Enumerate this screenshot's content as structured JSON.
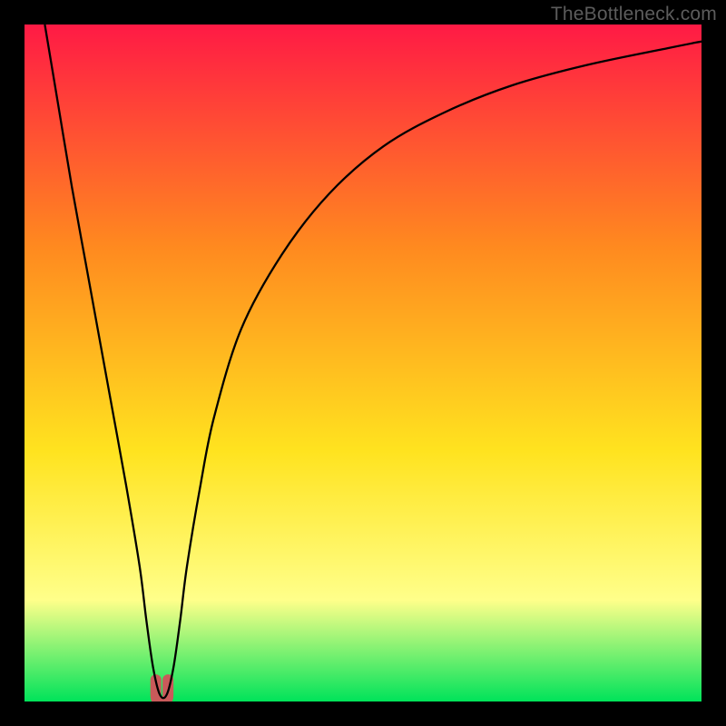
{
  "watermark": "TheBottleneck.com",
  "chart_data": {
    "type": "line",
    "title": "",
    "xlabel": "",
    "ylabel": "",
    "xlim": [
      0,
      100
    ],
    "ylim": [
      0,
      100
    ],
    "background_gradient": {
      "top": "#ff1a45",
      "mid1": "#ff8a1f",
      "mid2": "#ffe31f",
      "low": "#ffff8a",
      "bottom": "#00e35a"
    },
    "series": [
      {
        "name": "bottleneck-curve",
        "x": [
          3,
          5,
          7,
          9,
          11,
          13,
          15,
          17,
          18,
          19,
          20,
          21,
          22,
          23,
          24,
          26,
          28,
          32,
          38,
          45,
          53,
          62,
          72,
          83,
          95,
          100
        ],
        "y": [
          100,
          88,
          76,
          65,
          54,
          43,
          32,
          20,
          12,
          5,
          1,
          1,
          5,
          12,
          20,
          32,
          42,
          55,
          66,
          75,
          82,
          87,
          91,
          94,
          96.5,
          97.5
        ]
      }
    ],
    "marker": {
      "name": "optimal-zone",
      "x_center": 20.3,
      "y_bottom": 0,
      "height": 3.2,
      "width": 1.8,
      "color": "#c95a5a"
    }
  }
}
